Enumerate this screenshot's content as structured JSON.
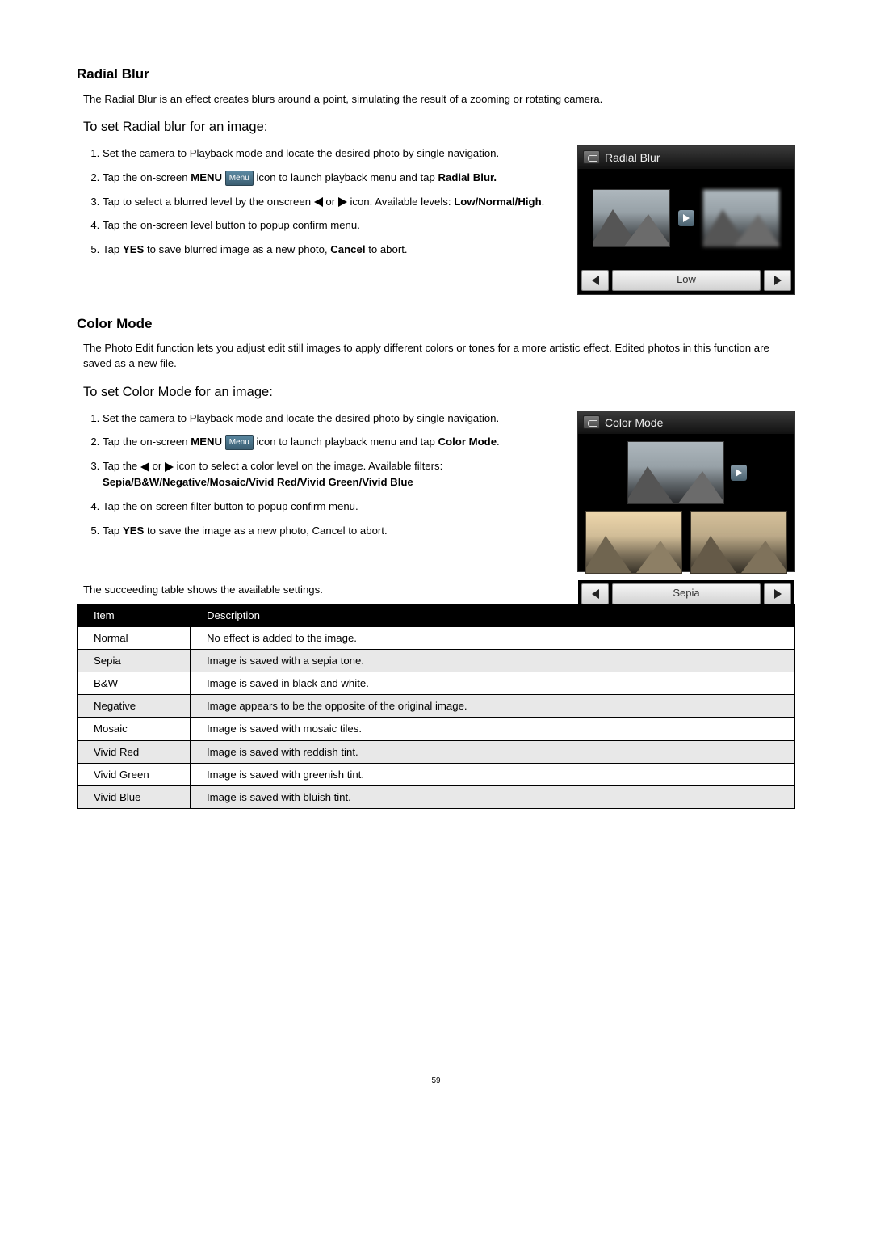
{
  "page_number": "59",
  "radial": {
    "heading": "Radial Blur",
    "intro": "The Radial Blur is an effect creates blurs around a point, simulating the result of a zooming or rotating camera.",
    "subhead": "To set Radial blur for an image:",
    "steps": {
      "s1": "Set the camera to Playback mode and locate the desired photo by single navigation.",
      "s2a": "Tap the on-screen ",
      "s2_menu_word": "MENU",
      "s2_chip": "Menu",
      "s2b": " icon to launch playback menu and tap ",
      "s2_bold_tail": "Radial Blur.",
      "s3a": "Tap to select a blurred level by the onscreen ",
      "s3_or": " or ",
      "s3b": " icon. Available levels: ",
      "s3_levels": "Low/Normal/High",
      "s3_tail": ".",
      "s4": "Tap the on-screen level button to popup confirm menu.",
      "s5a": "Tap ",
      "s5_yes": "YES",
      "s5b": " to save blurred image as a new photo, ",
      "s5_cancel": "Cancel",
      "s5c": " to abort."
    },
    "screen": {
      "title": "Radial Blur",
      "level": "Low"
    }
  },
  "color": {
    "heading": "Color Mode",
    "intro": "The Photo Edit function lets you adjust edit still images to apply different colors or tones for a more artistic effect. Edited photos in this function are saved as a new file.",
    "subhead": "To set Color Mode for an image:",
    "steps": {
      "s1": "Set the camera to Playback mode and locate the desired photo by single navigation.",
      "s2a": "Tap the on-screen ",
      "s2_menu_word": "MENU",
      "s2_chip": "Menu",
      "s2b": " icon to launch playback menu and tap ",
      "s2_bold_tail": "Color Mode",
      "s2_tail": ".",
      "s3a": "Tap the ",
      "s3_or": " or ",
      "s3b": " icon to select a color level on the image. Available filters: ",
      "s3_filters": "Sepia/B&W/Negative/Mosaic/Vivid Red/Vivid Green/Vivid Blue",
      "s4": "Tap the on-screen filter button to popup confirm menu.",
      "s5a": "Tap ",
      "s5_yes": "YES",
      "s5b": " to save the image as a new photo, Cancel to abort."
    },
    "screen": {
      "title": "Color Mode",
      "level": "Sepia"
    }
  },
  "table": {
    "note": "The succeeding table shows the available settings.",
    "headers": {
      "item": "Item",
      "desc": "Description"
    },
    "rows": [
      {
        "item": "Normal",
        "desc": "No effect is added to the image."
      },
      {
        "item": "Sepia",
        "desc": "Image is saved with a sepia tone."
      },
      {
        "item": "B&W",
        "desc": "Image is saved in black and white."
      },
      {
        "item": "Negative",
        "desc": "Image appears to be the opposite of the original image."
      },
      {
        "item": "Mosaic",
        "desc": "Image is saved with mosaic tiles."
      },
      {
        "item": "Vivid Red",
        "desc": "Image is saved with reddish tint."
      },
      {
        "item": "Vivid Green",
        "desc": "Image is saved with greenish tint."
      },
      {
        "item": "Vivid Blue",
        "desc": "Image is saved with bluish tint."
      }
    ]
  }
}
